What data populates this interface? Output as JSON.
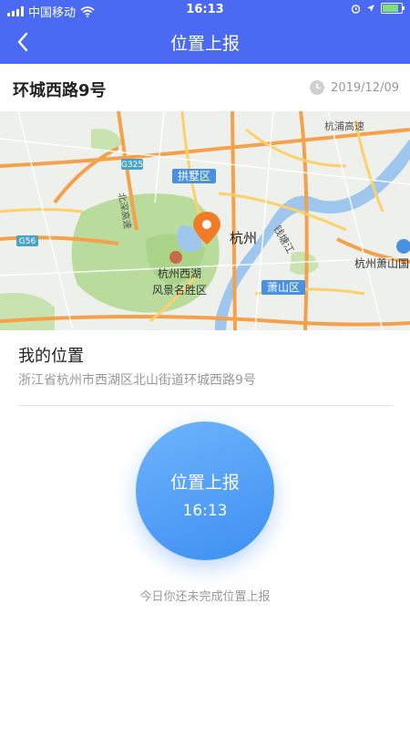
{
  "status_bar": {
    "carrier": "中国移动",
    "time": "16:13",
    "battery_level": 0.85
  },
  "nav": {
    "title": "位置上报",
    "back_icon": "chevron-left-icon"
  },
  "address": {
    "title": "环城西路9号",
    "date": "2019/12/09",
    "date_icon": "clock-icon"
  },
  "map": {
    "labels": {
      "gongshu": "拱墅区",
      "hangzhou": "杭州",
      "xihu_line1": "杭州西湖",
      "xihu_line2": "风景名胜区",
      "xiaoshan": "萧山区",
      "hangpu": "杭浦高速",
      "qiantang": "钱塘江",
      "airport": "杭州萧山国",
      "beisi": "北深高速",
      "g325": "G325",
      "g56": "G56"
    },
    "pin_icon": "location-pin-icon"
  },
  "my_location": {
    "title": "我的位置",
    "address": "浙江省杭州市西湖区北山街道环城西路9号"
  },
  "report": {
    "label": "位置上报",
    "time": "16:13"
  },
  "status_text": "今日你还未完成位置上报",
  "colors": {
    "header_bg": "#4a6af2",
    "button_gradient_start": "#6eb4fb",
    "button_gradient_end": "#3d8ff2",
    "pin": "#f07c28"
  }
}
